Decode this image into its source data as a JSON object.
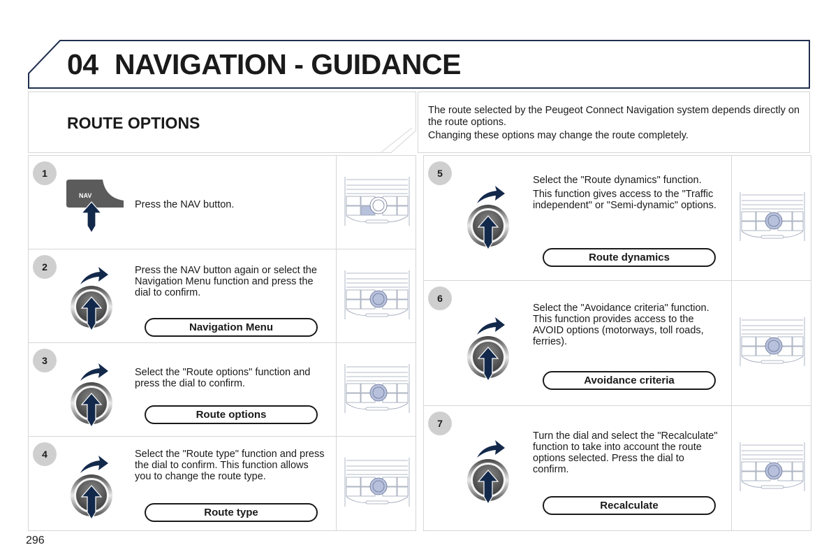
{
  "header": {
    "chapter_number": "04",
    "chapter_title": "NAVIGATION - GUIDANCE",
    "accent_color": "#1f2f4f"
  },
  "section": {
    "title": "ROUTE OPTIONS",
    "intro": [
      "The route selected by the Peugeot Connect Navigation system depends directly on the route options.",
      "Changing these options may change the route completely."
    ]
  },
  "steps": [
    {
      "number": "1",
      "icon": "nav-button-press-icon",
      "text": [
        "Press the NAV button."
      ],
      "button_label": null,
      "nav_label": "NAV",
      "thumb": "console-nav-highlight"
    },
    {
      "number": "2",
      "icon": "dial-rotate-press-icon",
      "text": [
        "Press the NAV button again or select the Navigation Menu function and press the dial to confirm."
      ],
      "button_label": "Navigation Menu",
      "thumb": "console-dial-highlight"
    },
    {
      "number": "3",
      "icon": "dial-rotate-press-icon",
      "text": [
        "Select the \"Route options\" function and press the dial to confirm."
      ],
      "button_label": "Route options",
      "thumb": "console-dial-highlight"
    },
    {
      "number": "4",
      "icon": "dial-rotate-press-icon",
      "text": [
        "Select the \"Route type\" function and press the dial to confirm. This function allows you to change the route type."
      ],
      "button_label": "Route type",
      "thumb": "console-dial-highlight"
    },
    {
      "number": "5",
      "icon": "dial-rotate-press-icon",
      "text": [
        "Select the \"Route dynamics\" function.",
        "This function gives access to the \"Traffic independent\" or \"Semi-dynamic\" options."
      ],
      "button_label": "Route dynamics",
      "thumb": "console-dial-highlight"
    },
    {
      "number": "6",
      "icon": "dial-rotate-press-icon",
      "text": [
        "Select the \"Avoidance criteria\" function. This function provides access to the AVOID options (motorways, toll roads, ferries)."
      ],
      "button_label": "Avoidance criteria",
      "thumb": "console-dial-highlight"
    },
    {
      "number": "7",
      "icon": "dial-rotate-press-icon",
      "text": [
        "Turn the dial and select the \"Recalculate\" function to take into account the route options selected. Press the dial to confirm."
      ],
      "button_label": "Recalculate",
      "thumb": "console-dial-highlight"
    }
  ],
  "page_number": "296"
}
